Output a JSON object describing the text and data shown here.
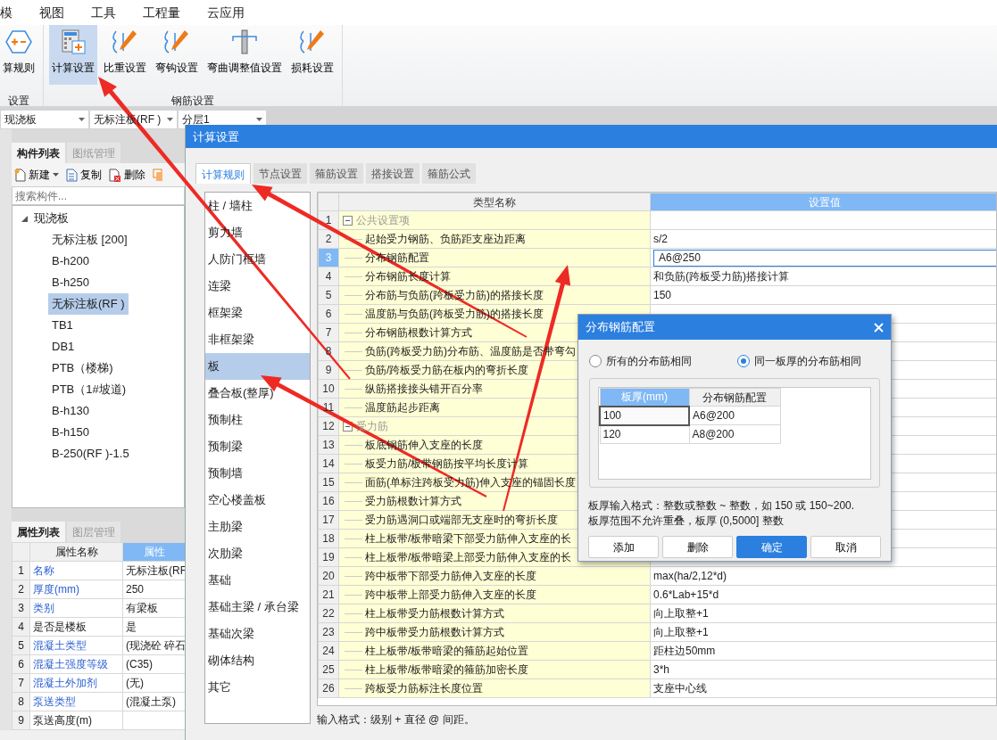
{
  "menu": [
    "模",
    "视图",
    "工具",
    "工程量",
    "云应用"
  ],
  "ribbon": {
    "groups": [
      {
        "label": "设置",
        "buttons": [
          {
            "label": "算规则",
            "kind": "rules",
            "selected": false
          }
        ]
      },
      {
        "label": "钢筋设置",
        "buttons": [
          {
            "label": "计算设置",
            "kind": "calculator",
            "selected": true
          },
          {
            "label": "比重设置",
            "kind": "density",
            "selected": false
          },
          {
            "label": "弯钩设置",
            "kind": "hook",
            "selected": false
          },
          {
            "label": "弯曲调整值设置",
            "kind": "bend",
            "selected": false
          },
          {
            "label": "损耗设置",
            "kind": "loss",
            "selected": false
          }
        ]
      }
    ]
  },
  "selectors": [
    "现浇板",
    "无标注板(RF )",
    "分层1"
  ],
  "component_panel": {
    "tabs": [
      {
        "label": "构件列表",
        "selected": true
      },
      {
        "label": "图纸管理",
        "selected": false
      }
    ],
    "toolbar": [
      {
        "label": "新建",
        "kind": "new"
      },
      {
        "label": "复制",
        "kind": "copy"
      },
      {
        "label": "删除",
        "kind": "delete"
      },
      {
        "kind": "more"
      }
    ],
    "search": {
      "placeholder": "搜索构件..."
    },
    "tree": [
      {
        "label": "现浇板",
        "expanded": true,
        "children": [
          {
            "label": "无标注板 [200]",
            "selected": false
          },
          {
            "label": "B-h200",
            "selected": false
          },
          {
            "label": "B-h250",
            "selected": false
          },
          {
            "label": "无标注板(RF )",
            "selected": true
          },
          {
            "label": "TB1",
            "selected": false
          },
          {
            "label": "DB1",
            "selected": false
          },
          {
            "label": "PTB（楼梯)",
            "selected": false
          },
          {
            "label": "PTB（1#坡道)",
            "selected": false
          },
          {
            "label": "B-h130",
            "selected": false
          },
          {
            "label": "B-h150",
            "selected": false
          },
          {
            "label": "B-250(RF )-1.5",
            "selected": false
          }
        ]
      }
    ]
  },
  "property_panel": {
    "tabs": [
      {
        "label": "属性列表",
        "selected": true
      },
      {
        "label": "图层管理",
        "selected": false
      }
    ],
    "columns": [
      {
        "label": "属性名称",
        "selected": false
      },
      {
        "label": "属性",
        "selected": true
      }
    ],
    "rows": [
      {
        "index": "1",
        "name": "名称",
        "value": "无标注板(RF",
        "linked": true
      },
      {
        "index": "2",
        "name": "厚度(mm)",
        "value": "250",
        "linked": true
      },
      {
        "index": "3",
        "name": "类别",
        "value": "有梁板",
        "linked": true
      },
      {
        "index": "4",
        "name": "是否是楼板",
        "value": "是",
        "linked": false
      },
      {
        "index": "5",
        "name": "混凝土类型",
        "value": "(现浇砼 碎石",
        "linked": true
      },
      {
        "index": "6",
        "name": "混凝土强度等级",
        "value": "(C35)",
        "linked": true
      },
      {
        "index": "7",
        "name": "混凝土外加剂",
        "value": "(无)",
        "linked": true
      },
      {
        "index": "8",
        "name": "泵送类型",
        "value": "(混凝土泵)",
        "linked": true
      },
      {
        "index": "9",
        "name": "泵送高度(m)",
        "linked": false
      }
    ]
  },
  "settings_dialog": {
    "title": "计算设置",
    "tabs": [
      {
        "label": "计算规则",
        "selected": true
      },
      {
        "label": "节点设置",
        "selected": false
      },
      {
        "label": "箍筋设置",
        "selected": false
      },
      {
        "label": "搭接设置",
        "selected": false
      },
      {
        "label": "箍筋公式",
        "selected": false
      }
    ],
    "categories": [
      {
        "label": "柱 / 墙柱",
        "selected": false
      },
      {
        "label": "剪力墙",
        "selected": false
      },
      {
        "label": "人防门框墙",
        "selected": false
      },
      {
        "label": "连梁",
        "selected": false
      },
      {
        "label": "框架梁",
        "selected": false
      },
      {
        "label": "非框架梁",
        "selected": false
      },
      {
        "label": "板",
        "selected": true
      },
      {
        "label": "叠合板(整厚)",
        "selected": false
      },
      {
        "label": "预制柱",
        "selected": false
      },
      {
        "label": "预制梁",
        "selected": false
      },
      {
        "label": "预制墙",
        "selected": false
      },
      {
        "label": "空心楼盖板",
        "selected": false
      },
      {
        "label": "主肋梁",
        "selected": false
      },
      {
        "label": "次肋梁",
        "selected": false
      },
      {
        "label": "基础",
        "selected": false
      },
      {
        "label": "基础主梁 / 承台梁",
        "selected": false
      },
      {
        "label": "基础次梁",
        "selected": false
      },
      {
        "label": "砌体结构",
        "selected": false
      },
      {
        "label": "其它",
        "selected": false
      }
    ],
    "grid": {
      "columns": [
        {
          "label": "类型名称",
          "selected": false
        },
        {
          "label": "设置值",
          "selected": true
        }
      ],
      "rows": [
        {
          "index": "1",
          "kind": "group",
          "name": "公共设置项",
          "expanded": true,
          "selected": false
        },
        {
          "index": "2",
          "kind": "item",
          "name": "起始受力钢筋、负筋距支座边距离",
          "value": "s/2",
          "selected": false
        },
        {
          "index": "3",
          "kind": "item",
          "name": "分布钢筋配置",
          "value": "A6@250",
          "selected": true
        },
        {
          "index": "4",
          "kind": "item",
          "name": "分布钢筋长度计算",
          "value": "和负筋(跨板受力筋)搭接计算",
          "selected": false
        },
        {
          "index": "5",
          "kind": "item",
          "name": "分布筋与负筋(跨板受力筋)的搭接长度",
          "value": "150",
          "selected": false
        },
        {
          "index": "6",
          "kind": "item",
          "name": "温度筋与负筋(跨板受力筋)的搭接长度",
          "selected": false
        },
        {
          "index": "7",
          "kind": "item",
          "name": "分布钢筋根数计算方式",
          "selected": false
        },
        {
          "index": "8",
          "kind": "item",
          "name": "负筋(跨板受力筋)分布筋、温度筋是否带弯勾",
          "selected": false
        },
        {
          "index": "9",
          "kind": "item",
          "name": "负筋/跨板受力筋在板内的弯折长度",
          "selected": false
        },
        {
          "index": "10",
          "kind": "item",
          "name": "纵筋搭接接头错开百分率",
          "selected": false
        },
        {
          "index": "11",
          "kind": "item",
          "name": "温度筋起步距离",
          "selected": false
        },
        {
          "index": "12",
          "kind": "group",
          "name": "受力筋",
          "expanded": true,
          "selected": false
        },
        {
          "index": "13",
          "kind": "item",
          "name": "板底钢筋伸入支座的长度",
          "selected": false
        },
        {
          "index": "14",
          "kind": "item",
          "name": "板受力筋/板带钢筋按平均长度计算",
          "selected": false
        },
        {
          "index": "15",
          "kind": "item",
          "name": "面筋(单标注跨板受力筋)伸入支座的锚固长度",
          "selected": false
        },
        {
          "index": "16",
          "kind": "item",
          "name": "受力筋根数计算方式",
          "selected": false
        },
        {
          "index": "17",
          "kind": "item",
          "name": "受力筋遇洞口或端部无支座时的弯折长度",
          "selected": false
        },
        {
          "index": "18",
          "kind": "item",
          "name": "柱上板带/板带暗梁下部受力筋伸入支座的长",
          "selected": false
        },
        {
          "index": "19",
          "kind": "item",
          "name": "柱上板带/板带暗梁上部受力筋伸入支座的长",
          "selected": false
        },
        {
          "index": "20",
          "kind": "item",
          "name": "跨中板带下部受力筋伸入支座的长度",
          "value": "max(ha/2,12*d)",
          "selected": false
        },
        {
          "index": "21",
          "kind": "item",
          "name": "跨中板带上部受力筋伸入支座的长度",
          "value": "0.6*Lab+15*d",
          "selected": false
        },
        {
          "index": "22",
          "kind": "item",
          "name": "柱上板带受力筋根数计算方式",
          "value": "向上取整+1",
          "selected": false
        },
        {
          "index": "23",
          "kind": "item",
          "name": "跨中板带受力筋根数计算方式",
          "value": "向上取整+1",
          "selected": false
        },
        {
          "index": "24",
          "kind": "item",
          "name": "柱上板带/板带暗梁的箍筋起始位置",
          "value": "距柱边50mm",
          "selected": false
        },
        {
          "index": "25",
          "kind": "item",
          "name": "柱上板带/板带暗梁的箍筋加密长度",
          "value": "3*h",
          "selected": false
        },
        {
          "index": "26",
          "kind": "item",
          "name": "跨板受力筋标注长度位置",
          "value": "支座中心线",
          "selected": false
        }
      ]
    },
    "hint": "输入格式：级别 + 直径 @ 间距。"
  },
  "rebar_dialog": {
    "title": "分布钢筋配置",
    "options": [
      {
        "label": "所有的分布筋相同",
        "selected": false
      },
      {
        "label": "同一板厚的分布筋相同",
        "selected": true
      }
    ],
    "table": {
      "columns": [
        {
          "label": "板厚(mm)",
          "selected": true
        },
        {
          "label": "分布钢筋配置",
          "selected": false
        }
      ],
      "rows": [
        {
          "thickness": "100",
          "config": "A6@200",
          "focused": true
        },
        {
          "thickness": "120",
          "config": "A8@200",
          "focused": false
        }
      ]
    },
    "note": [
      "板厚输入格式：整数或整数 ~ 整数，如 150 或 150~200.",
      "板厚范围不允许重叠，板厚 (0,5000] 整数"
    ],
    "buttons": [
      {
        "label": "添加",
        "kind": "default"
      },
      {
        "label": "删除",
        "kind": "default"
      },
      {
        "label": "确定",
        "kind": "primary"
      },
      {
        "label": "取消",
        "kind": "default"
      }
    ]
  },
  "annotation_arrows": [
    {
      "kind": "arrow"
    },
    {
      "kind": "arrow"
    },
    {
      "kind": "arrow"
    },
    {
      "kind": "arrow"
    }
  ]
}
